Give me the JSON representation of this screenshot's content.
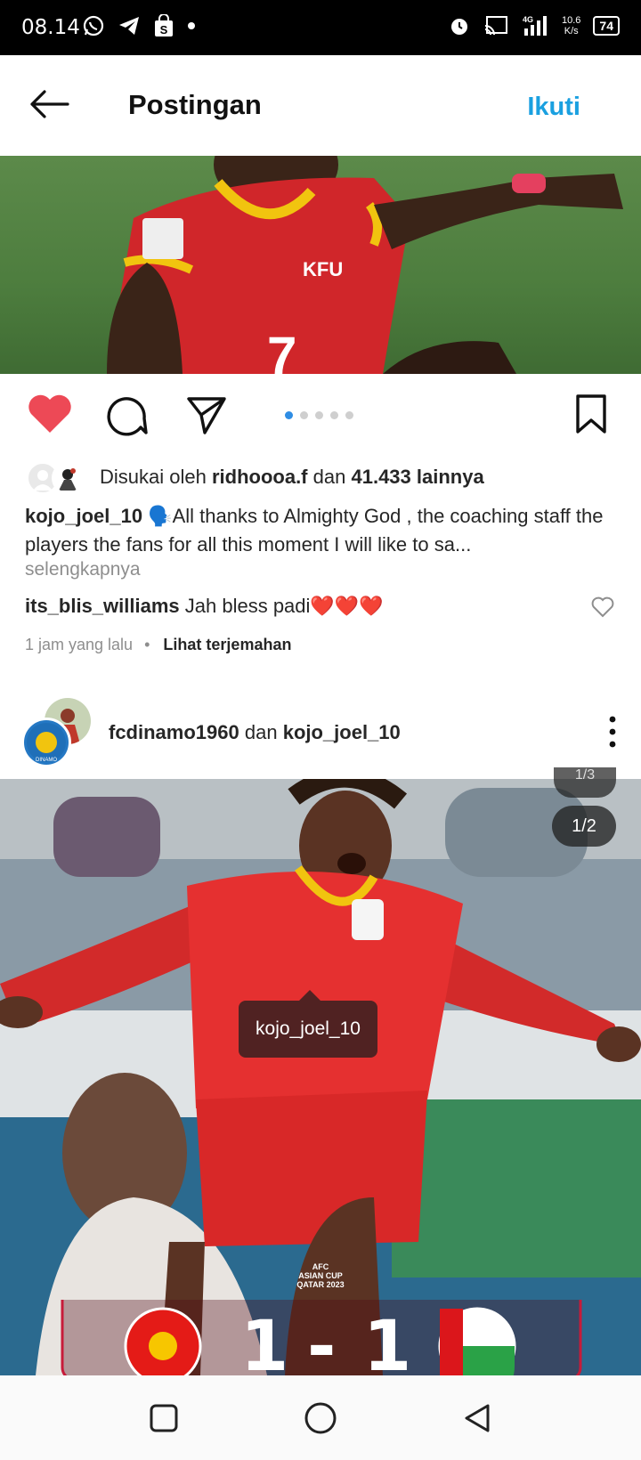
{
  "status_bar": {
    "time": "08.14",
    "network": "4G",
    "speed_value": "10.6",
    "speed_unit": "K/s",
    "battery": "74"
  },
  "header": {
    "title": "Postingan",
    "follow_label": "Ikuti"
  },
  "post1": {
    "carousel_count": 5,
    "carousel_active": 0,
    "likes": {
      "prefix": "Disukai oleh",
      "user": "ridhoooa.f",
      "joiner": "dan",
      "count": "41.433 lainnya"
    },
    "caption": {
      "author": "kojo_joel_10",
      "emoji": "🗣️",
      "text": "All thanks to Almighty God , the coaching staff the players  the fans for all this moment I will like to sa..."
    },
    "more_label": "selengkapnya",
    "comment": {
      "author": "its_blis_williams",
      "text": "Jah bless padi❤️❤️❤️"
    },
    "time_ago": "1 jam yang lalu",
    "separator": "•",
    "translate_label": "Lihat terjemahan"
  },
  "post2": {
    "user1": "fcdinamo1960",
    "joiner": "dan",
    "user2": "kojo_joel_10",
    "counter_ghost": "1/3",
    "counter": "1/2",
    "tag": "kojo_joel_10",
    "cup_line1": "AFC",
    "cup_line2": "ASIAN CUP",
    "cup_line3": "QATAR 2023",
    "score_home": "1",
    "score_sep": "-",
    "score_away": "1"
  },
  "colors": {
    "accent_blue": "#1aa0e0",
    "like_red": "#ed4956",
    "dot_active": "#2f8de4"
  },
  "icons": [
    "whatsapp-icon",
    "telegram-icon",
    "shop-icon",
    "alarm-icon",
    "cast-icon",
    "signal-icon",
    "back-arrow-icon",
    "heart-icon",
    "comment-icon",
    "share-icon",
    "bookmark-icon",
    "more-vertical-icon"
  ]
}
